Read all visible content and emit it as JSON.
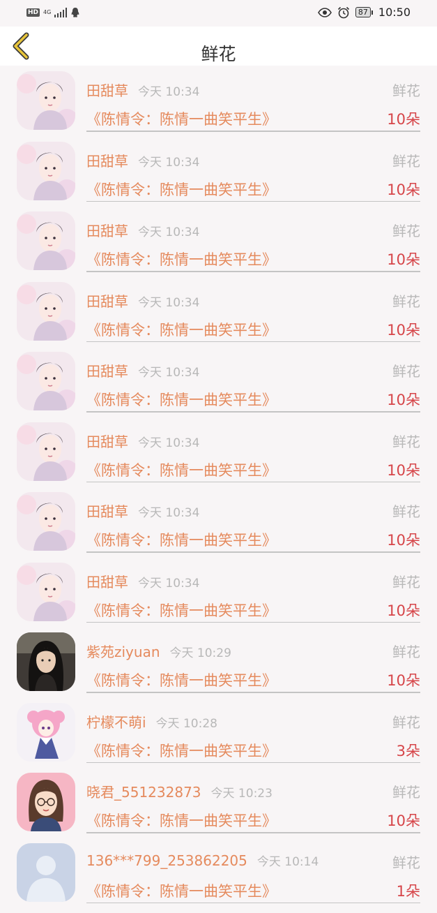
{
  "status_bar": {
    "hd": "HD",
    "network": "4G",
    "battery": "87",
    "time": "10:50"
  },
  "header": {
    "title": "鲜花",
    "back_icon": "chevron-left-icon"
  },
  "colors": {
    "accent": "#e58a5d",
    "amount": "#d64549",
    "muted": "#b8b8b8"
  },
  "gifts": [
    {
      "user": "田甜草",
      "time": "今天 10:34",
      "type": "鲜花",
      "novel": "《陈情令：陈情一曲笑平生》",
      "amount": "10朵",
      "avatar": "avatar-girl"
    },
    {
      "user": "田甜草",
      "time": "今天 10:34",
      "type": "鲜花",
      "novel": "《陈情令：陈情一曲笑平生》",
      "amount": "10朵",
      "avatar": "avatar-girl"
    },
    {
      "user": "田甜草",
      "time": "今天 10:34",
      "type": "鲜花",
      "novel": "《陈情令：陈情一曲笑平生》",
      "amount": "10朵",
      "avatar": "avatar-girl"
    },
    {
      "user": "田甜草",
      "time": "今天 10:34",
      "type": "鲜花",
      "novel": "《陈情令：陈情一曲笑平生》",
      "amount": "10朵",
      "avatar": "avatar-girl"
    },
    {
      "user": "田甜草",
      "time": "今天 10:34",
      "type": "鲜花",
      "novel": "《陈情令：陈情一曲笑平生》",
      "amount": "10朵",
      "avatar": "avatar-girl"
    },
    {
      "user": "田甜草",
      "time": "今天 10:34",
      "type": "鲜花",
      "novel": "《陈情令：陈情一曲笑平生》",
      "amount": "10朵",
      "avatar": "avatar-girl"
    },
    {
      "user": "田甜草",
      "time": "今天 10:34",
      "type": "鲜花",
      "novel": "《陈情令：陈情一曲笑平生》",
      "amount": "10朵",
      "avatar": "avatar-girl"
    },
    {
      "user": "田甜草",
      "time": "今天 10:34",
      "type": "鲜花",
      "novel": "《陈情令：陈情一曲笑平生》",
      "amount": "10朵",
      "avatar": "avatar-girl"
    },
    {
      "user": "紫苑ziyuan",
      "time": "今天 10:29",
      "type": "鲜花",
      "novel": "《陈情令：陈情一曲笑平生》",
      "amount": "10朵",
      "avatar": "avatar-man"
    },
    {
      "user": "柠檬不萌i",
      "time": "今天 10:28",
      "type": "鲜花",
      "novel": "《陈情令：陈情一曲笑平生》",
      "amount": "3朵",
      "avatar": "avatar-anime"
    },
    {
      "user": "晓君_551232873",
      "time": "今天 10:23",
      "type": "鲜花",
      "novel": "《陈情令：陈情一曲笑平生》",
      "amount": "10朵",
      "avatar": "avatar-cartoon"
    },
    {
      "user": "136***799_253862205",
      "time": "今天 10:14",
      "type": "鲜花",
      "novel": "《陈情令：陈情一曲笑平生》",
      "amount": "1朵",
      "avatar": "avatar-default"
    }
  ]
}
